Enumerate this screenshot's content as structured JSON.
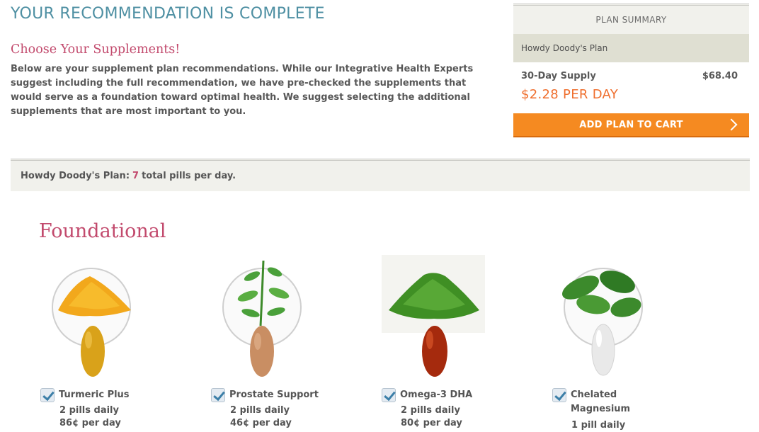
{
  "header": {
    "title": "YOUR RECOMMENDATION IS COMPLETE",
    "subtitle": "Choose Your Supplements!",
    "intro": "Below are your supplement plan recommendations. While our Integrative Health Experts suggest including the full recommendation, we have pre-checked the supplements that would serve as a foundation toward optimal health. We suggest selecting the additional supplements that are most important to you."
  },
  "summary": {
    "heading": "PLAN SUMMARY",
    "plan_name": "Howdy Doody's Plan",
    "supply_label": "30-Day Supply",
    "supply_price": "$68.40",
    "per_day": "$2.28 PER DAY",
    "cart_label": "ADD PLAN TO CART"
  },
  "plan_bar": {
    "prefix": "Howdy Doody's Plan:",
    "count": "7",
    "suffix": "total pills per day."
  },
  "section": {
    "title": "Foundational"
  },
  "products": [
    {
      "name": "Turmeric Plus",
      "dose": "2 pills daily",
      "price": "86¢ per day",
      "checked": true,
      "pill_color": "#d9a21a",
      "icon": "turmeric-powder-icon"
    },
    {
      "name": "Prostate Support",
      "dose": "2 pills daily",
      "price": "46¢ per day",
      "checked": true,
      "pill_color": "#c98e63",
      "icon": "plant-sprout-icon"
    },
    {
      "name": "Omega-3 DHA",
      "dose": "2 pills daily",
      "price": "80¢ per day",
      "checked": true,
      "pill_color": "#a52a0d",
      "icon": "green-powder-icon"
    },
    {
      "name": "Chelated Magnesium",
      "dose": "1 pill daily",
      "price": "",
      "checked": true,
      "pill_color": "#e9e9e9",
      "icon": "spinach-leaves-icon"
    }
  ],
  "colors": {
    "title": "#4f90a3",
    "accent_pink": "#c24a6d",
    "price_orange": "#ef6e2d",
    "button_orange": "#f58a21",
    "panel_beige": "#f1f1ec"
  }
}
